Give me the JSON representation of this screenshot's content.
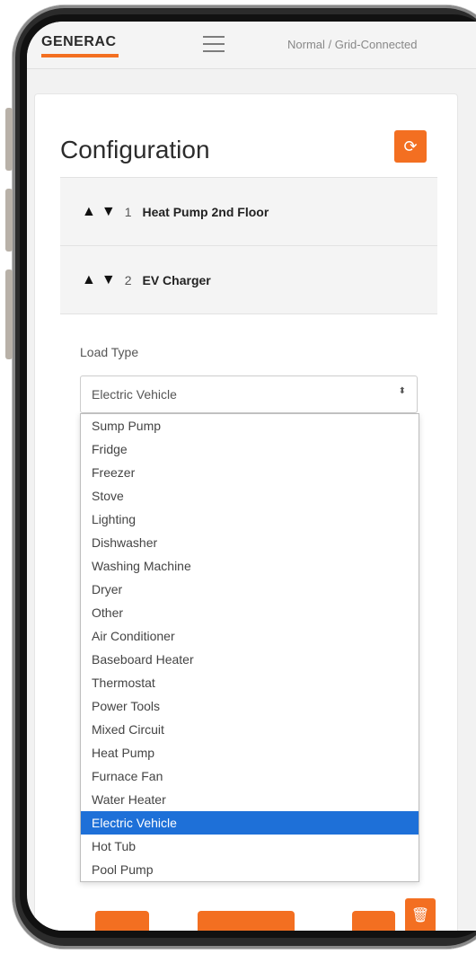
{
  "header": {
    "logo": "GENERAC",
    "status": "Normal / Grid-Connected",
    "menu_icon": "hamburger-menu-icon"
  },
  "page": {
    "title": "Configuration",
    "refresh_icon": "refresh-icon"
  },
  "loads": [
    {
      "number": "1",
      "name": "Heat Pump 2nd Floor"
    },
    {
      "number": "2",
      "name": "EV Charger"
    }
  ],
  "load_type": {
    "label": "Load Type",
    "value": "Electric Vehicle",
    "options": [
      "Sump Pump",
      "Fridge",
      "Freezer",
      "Stove",
      "Lighting",
      "Dishwasher",
      "Washing Machine",
      "Dryer",
      "Other",
      "Air Conditioner",
      "Baseboard Heater",
      "Thermostat",
      "Power Tools",
      "Mixed Circuit",
      "Heat Pump",
      "Furnace Fan",
      "Water Heater",
      "Electric Vehicle",
      "Hot Tub",
      "Pool Pump"
    ]
  },
  "icons": {
    "move_up": "▲",
    "move_down": "▼",
    "select_arrow": "⬍",
    "refresh": "⟳",
    "trash": "🗑"
  },
  "colors": {
    "accent": "#f36f21",
    "selected": "#1e70d8"
  }
}
